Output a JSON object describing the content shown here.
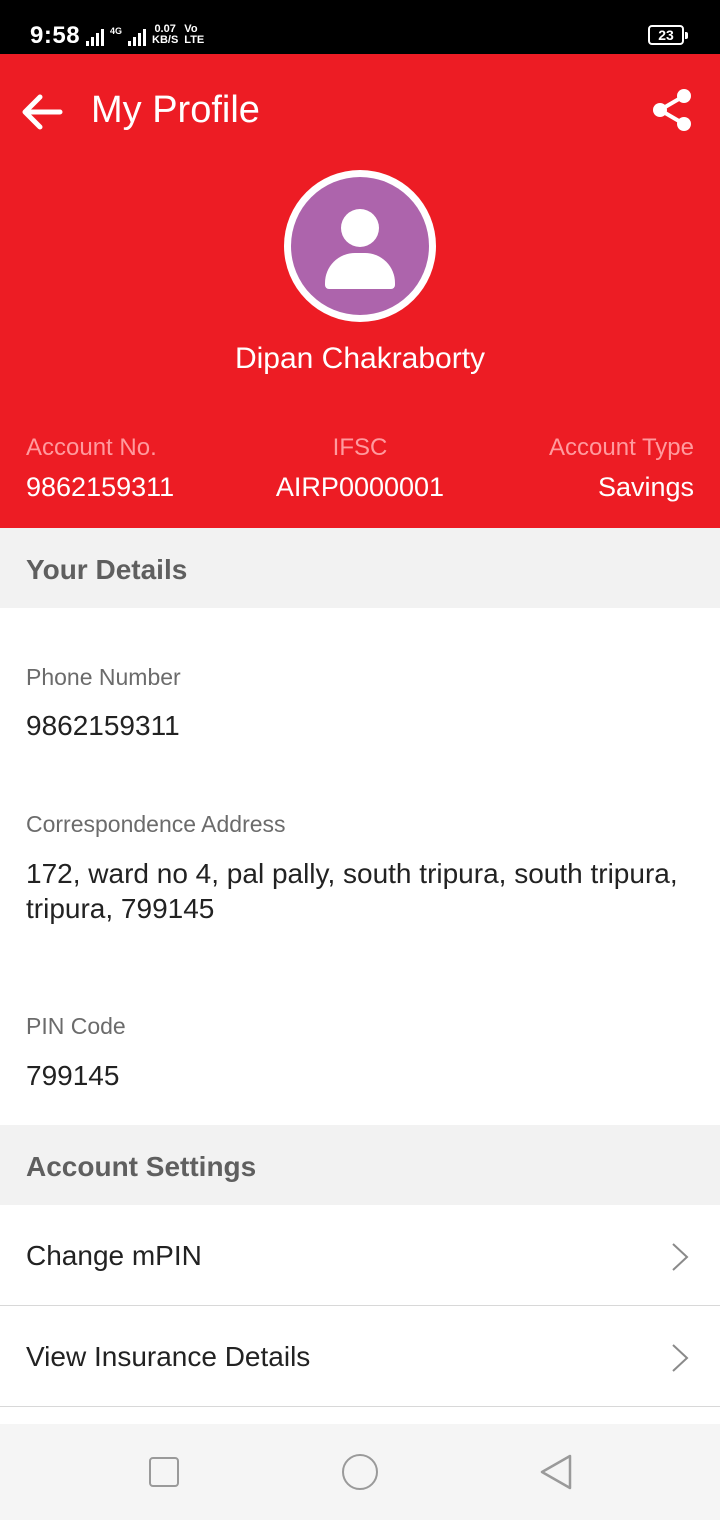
{
  "status_bar": {
    "time": "9:58",
    "network_tiny": "4G",
    "speed_value": "0.07",
    "speed_unit": "KB/S",
    "volte_top": "Vo",
    "volte_bottom": "LTE",
    "battery": "23"
  },
  "header": {
    "title": "My Profile",
    "user_name": "Dipan Chakraborty",
    "accent_color": "#ed1c24"
  },
  "account": {
    "number_label": "Account No.",
    "number_value": "9862159311",
    "ifsc_label": "IFSC",
    "ifsc_value": "AIRP0000001",
    "type_label": "Account Type",
    "type_value": "Savings"
  },
  "details": {
    "section_title": "Your Details",
    "phone_label": "Phone Number",
    "phone_value": "9862159311",
    "address_label": "Correspondence Address",
    "address_value": "172, ward no 4, pal pally, south tripura, south tripura, tripura, 799145",
    "pin_label": "PIN Code",
    "pin_value": "799145"
  },
  "settings": {
    "section_title": "Account Settings",
    "items": [
      {
        "label": "Change mPIN"
      },
      {
        "label": "View Insurance Details"
      }
    ]
  }
}
